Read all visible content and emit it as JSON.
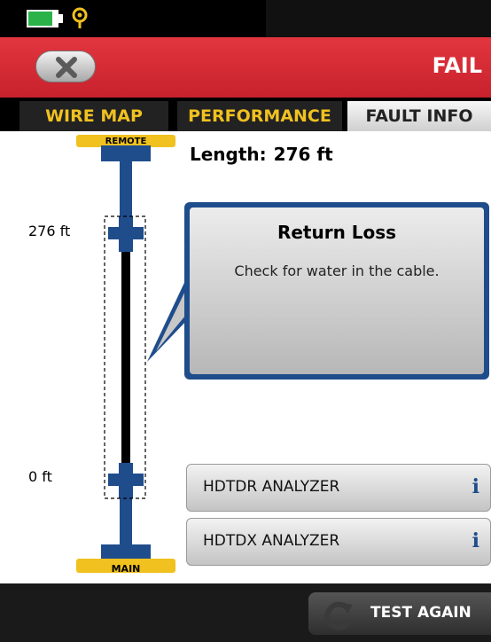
{
  "status_bar": {
    "battery_level_fraction": 0.85,
    "battery_color": "#2bb34a"
  },
  "header": {
    "result": "FAIL",
    "close_icon": "close-x-icon",
    "header_color": "#d42a33"
  },
  "tabs": [
    {
      "label": "WIRE MAP",
      "selected": false
    },
    {
      "label": "PERFORMANCE",
      "selected": false
    },
    {
      "label": "FAULT INFO",
      "selected": true
    }
  ],
  "cable": {
    "remote_label": "REMOTE",
    "main_label": "MAIN",
    "top_distance": "276 ft",
    "bottom_distance": "0 ft"
  },
  "length": {
    "label": "Length:",
    "value": "276 ft"
  },
  "fault": {
    "title": "Return Loss",
    "message": "Check for water in the cable."
  },
  "analyzers": [
    {
      "label": "HDTDR ANALYZER",
      "icon": "info-icon"
    },
    {
      "label": "HDTDX ANALYZER",
      "icon": "info-icon"
    }
  ],
  "footer": {
    "test_again": "TEST AGAIN",
    "icon": "refresh-icon"
  }
}
